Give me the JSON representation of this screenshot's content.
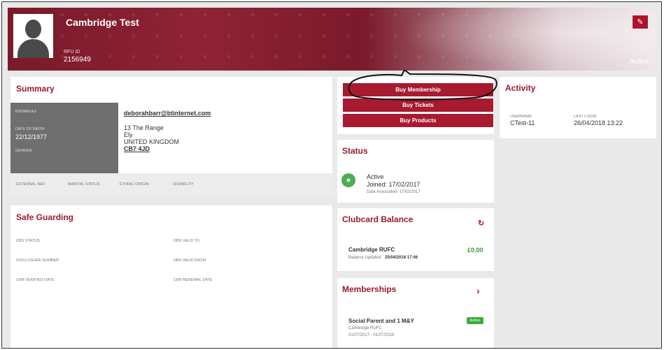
{
  "profile": {
    "name": "Cambridge Test",
    "rfu_id_label": "RFU ID",
    "rfu_id": "2156949",
    "status": "Active"
  },
  "summary": {
    "title": "Summary",
    "known_as_label": "KNOWN AS",
    "dob_label": "DATE OF BIRTH",
    "dob": "22/12/1977",
    "gender_label": "GENDER",
    "email": "deborahbarr@btinternet.com",
    "address_line1": "13 The Range",
    "address_line2": "Ely",
    "address_line3": "UNITED KINGDOM",
    "postcode": "CB7 4JD",
    "external_ref_label": "EXTERNAL REF",
    "marital_status_label": "MARITAL STATUS",
    "ethnic_origin_label": "ETHNIC ORIGIN",
    "disability_label": "DISABILITY"
  },
  "safeguarding": {
    "title": "Safe Guarding",
    "dbs_status_label": "DBS STATUS",
    "dbs_valid_to_label": "DBS VALID TO",
    "disclosure_number_label": "DISCLOSURE NUMBER",
    "dbs_valid_from_label": "DBS VALID FROM",
    "crb_verified_label": "CRB VERIFIED DATE",
    "crb_renewal_label": "CRB RENEWAL DATE"
  },
  "actions": {
    "buy_membership": "Buy Membership",
    "buy_tickets": "Buy Tickets",
    "buy_products": "Buy Products"
  },
  "status_panel": {
    "title": "Status",
    "state": "Active",
    "joined": "Joined: 17/02/2017",
    "associated": "Date Associated: 17/02/2017"
  },
  "clubcard": {
    "title": "Clubcard Balance",
    "club": "Cambridge RUFC",
    "amount": "£0.00",
    "updated_label": "Balance Updated:",
    "updated": "25/04/2018 17:46"
  },
  "memberships": {
    "title": "Memberships",
    "name": "Social Parent and 1 M&Y",
    "club": "Cambridge RUFC",
    "period": "01/07/2017 - 01/07/2018",
    "badge": "Active"
  },
  "activity": {
    "title": "Activity",
    "username_label": "USERNAME",
    "username": "CTest-11",
    "last_login_label": "LAST LOGIN",
    "last_login": "26/04/2018 13:22"
  },
  "colors": {
    "brand": "#a71a30",
    "active_green": "#4caf50"
  },
  "icons": {
    "edit": "pencil-icon",
    "refresh": "refresh-icon",
    "chevron": "chevron-right-icon",
    "status": "user-icon"
  }
}
